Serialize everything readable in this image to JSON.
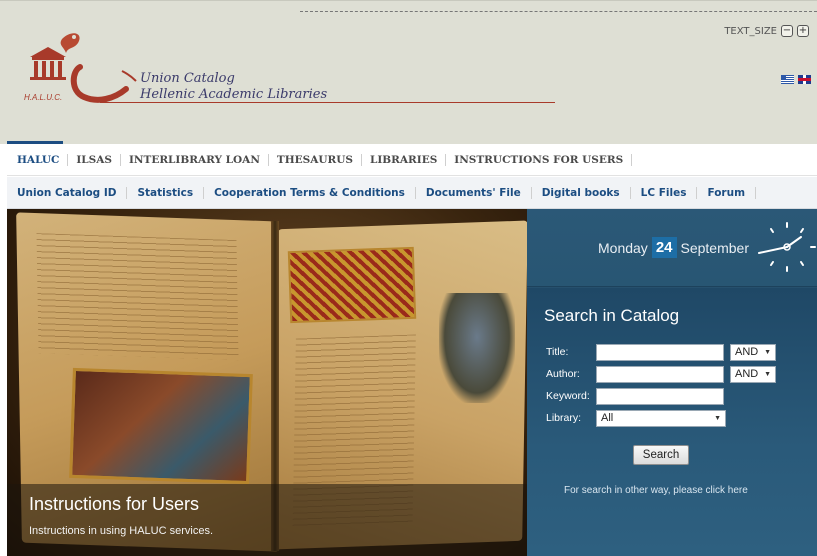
{
  "header": {
    "logo_abbr": "H.A.L.U.C.",
    "logo_line1": "Union Catalog",
    "logo_line2": "Hellenic Academic Libraries",
    "text_size_label": "TEXT_SIZE",
    "text_size_minus": "−",
    "text_size_plus": "+",
    "flags": [
      "greek-flag",
      "uk-flag"
    ]
  },
  "nav_primary": [
    {
      "label": "HALUC"
    },
    {
      "label": "ILSAS"
    },
    {
      "label": "INTERLIBRARY LOAN"
    },
    {
      "label": "THESAURUS"
    },
    {
      "label": "LIBRARIES"
    },
    {
      "label": "INSTRUCTIONS FOR USERS"
    }
  ],
  "nav_secondary": [
    {
      "label": "Union Catalog ID"
    },
    {
      "label": "Statistics"
    },
    {
      "label": "Cooperation Terms & Conditions"
    },
    {
      "label": "Documents' File"
    },
    {
      "label": "Digital books"
    },
    {
      "label": "LC Files"
    },
    {
      "label": "Forum"
    }
  ],
  "hero": {
    "title": "Instructions for Users",
    "subtitle": "Instructions in using HALUC services."
  },
  "date": {
    "weekday": "Monday",
    "day": "24",
    "month": "September"
  },
  "search": {
    "title": "Search in Catalog",
    "fields": {
      "title_label": "Title:",
      "author_label": "Author:",
      "keyword_label": "Keyword:",
      "library_label": "Library:"
    },
    "operator_title": "AND",
    "operator_author": "AND",
    "library_selected": "All",
    "button_label": "Search",
    "other_way_text": "For search in other way, please click here"
  },
  "colors": {
    "brand_blue": "#1c4d82",
    "panel_blue": "#26506d",
    "header_bg": "#dedfd4"
  }
}
